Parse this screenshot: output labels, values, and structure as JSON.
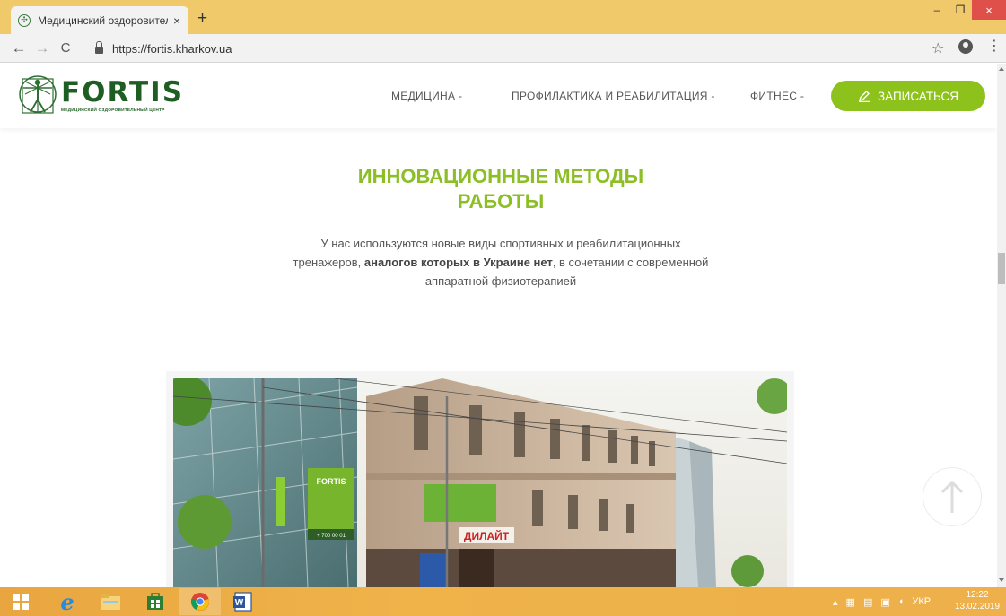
{
  "browser": {
    "tab_title": "Медицинский оздоровительный центр",
    "tab_close": "×",
    "new_tab": "+",
    "url": "https://fortis.kharkov.ua",
    "back": "←",
    "forward": "→",
    "reload": "C",
    "star": "☆",
    "menu": "⋮",
    "window": {
      "minimize": "–",
      "restore": "❐",
      "close": "×"
    }
  },
  "header": {
    "logo_word": "FORTIS",
    "logo_sub": "МЕДИЦИНСКИЙ ОЗДОРОВИТЕЛЬНЫЙ ЦЕНТР",
    "nav": [
      {
        "label": "МЕДИЦИНА -"
      },
      {
        "label": "ПРОФИЛАКТИКА И РЕАБИЛИТАЦИЯ -"
      },
      {
        "label": "ФИТНЕС -"
      }
    ],
    "cta_label": "ЗАПИСАТЬСЯ"
  },
  "main": {
    "heading_line1": "ИННОВАЦИОННЫЕ МЕТОДЫ",
    "heading_line2": "РАБОТЫ",
    "desc_part1": "У нас используются новые виды спортивных и реабилитационных тренажеров, ",
    "desc_bold": "аналогов которых в Украине нет",
    "desc_part2": ", в сочетании с современной аппаратной физиотерапией",
    "photo_signs": {
      "fortis": "FORTIS",
      "dilight": "ДИЛАЙТ",
      "phone": "+ 700 00 01"
    }
  },
  "taskbar": {
    "language": "УКР",
    "time": "12:22",
    "date": "13.02.2019"
  },
  "colors": {
    "accent_green": "#8cc21b",
    "logo_green": "#1e5e23",
    "tabstrip": "#f0c96a",
    "taskbar": "#edb04a"
  }
}
